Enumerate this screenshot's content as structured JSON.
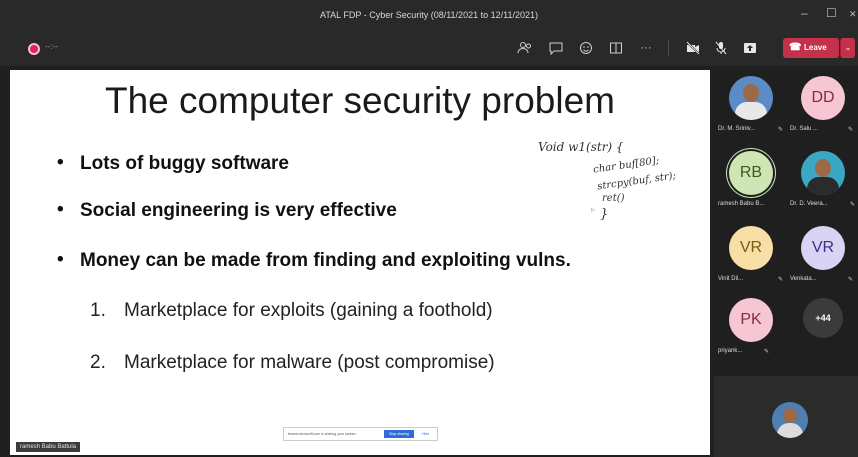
{
  "window": {
    "title": "ATAL FDP - Cyber Security (08/11/2021 to 12/11/2021)",
    "minimize": "–",
    "maximize": "☐",
    "close": "✕"
  },
  "toolbar": {
    "record_time": "--:--",
    "leave_label": "Leave",
    "more": "···"
  },
  "slide": {
    "title": "The computer security problem",
    "bullets": [
      "Lots of buggy software",
      "Social engineering is very effective",
      "Money can be made from finding and exploiting vulns."
    ],
    "numbered": [
      {
        "num": "1.",
        "text": "Marketplace for exploits (gaining a foothold)"
      },
      {
        "num": "2.",
        "text": "Marketplace for malware (post compromise)"
      }
    ],
    "handwriting": [
      "Void   w1(str) {",
      "char buf[80];",
      "strcpy(buf, str);",
      "ret()",
      "}"
    ]
  },
  "share_bar": {
    "message": "teams.microsoft.com is sharing your screen.",
    "stop_label": "Stop sharing",
    "hide_label": "Hide"
  },
  "presenter_label": "ramesh Babu Battula",
  "participants": [
    {
      "name": "Dr. M. Sriniv...",
      "initials": "",
      "color": ""
    },
    {
      "name": "Dr. Salu ...",
      "initials": "DD",
      "color": "#f6c6d3"
    },
    {
      "name": "ramesh Babu B...",
      "initials": "RB",
      "color": "#cde6b4"
    },
    {
      "name": "Dr. D. Veera...",
      "initials": "",
      "color": ""
    },
    {
      "name": "Vinit Dil...",
      "initials": "VR",
      "color": "#f7dfa6"
    },
    {
      "name": "Venkata...",
      "initials": "VR",
      "color": "#d9d3f4"
    },
    {
      "name": "priyank...",
      "initials": "PK",
      "color": "#f6c6d3"
    }
  ],
  "more_participants": "+44"
}
